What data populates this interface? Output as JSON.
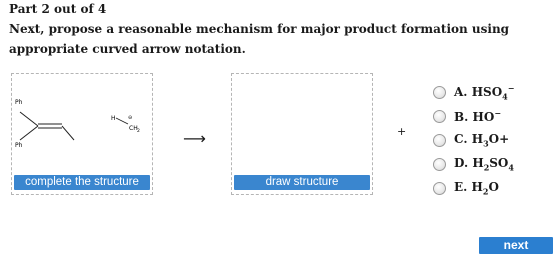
{
  "header": {
    "part": "Part 2 out of 4",
    "question": "Next, propose a reasonable mechanism for major product formation using appropriate curved arrow notation."
  },
  "reactant_box": {
    "button_label": "complete the structure",
    "labels": {
      "ph_top": "Ph",
      "ph_bottom": "Ph",
      "h": "H",
      "ch2": "CH",
      "ch2_sub": "2",
      "charge": "⊖"
    }
  },
  "product_box": {
    "button_label": "draw structure"
  },
  "arrow": "⟶",
  "plus": "+",
  "options": [
    {
      "letter": "A.",
      "base": "HSO",
      "sub": "4",
      "sup": "−"
    },
    {
      "letter": "B.",
      "base": "HO",
      "sub": "",
      "sup": "−"
    },
    {
      "letter": "C.",
      "pre": "H",
      "pre_sub": "3",
      "base": "O+",
      "sub": "",
      "sup": ""
    },
    {
      "letter": "D.",
      "pre": "H",
      "pre_sub": "2",
      "base": "SO",
      "sub": "4",
      "sup": ""
    },
    {
      "letter": "E.",
      "pre": "H",
      "pre_sub": "2",
      "base": "O",
      "sub": "",
      "sup": ""
    }
  ],
  "next_label": "next"
}
